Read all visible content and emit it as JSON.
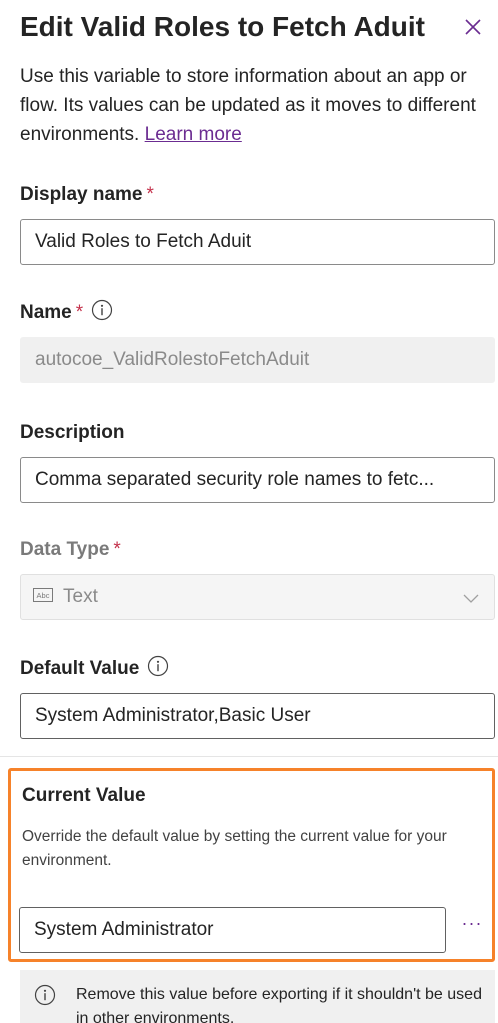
{
  "panel": {
    "title": "Edit Valid Roles to Fetch Aduit",
    "intro_text": "Use this variable to store information about an app or flow. Its values can be updated as it moves to different environments.",
    "learn_more": "Learn more"
  },
  "fields": {
    "display_name": {
      "label": "Display name",
      "required_mark": "*",
      "value": "Valid Roles to Fetch Aduit"
    },
    "name": {
      "label": "Name",
      "required_mark": "*",
      "value": "autocoe_ValidRolestoFetchAduit"
    },
    "description": {
      "label": "Description",
      "value": "Comma separated security role names to fetc..."
    },
    "data_type": {
      "label": "Data Type",
      "required_mark": "*",
      "value": "Text",
      "icon": "abc-text-icon"
    },
    "default_value": {
      "label": "Default Value",
      "value": "System Administrator,Basic User"
    },
    "current_value": {
      "label": "Current Value",
      "description": "Override the default value by setting the current value for your environment.",
      "value": "System Administrator",
      "more_label": "···"
    }
  },
  "notice": {
    "text": "Remove this value before exporting if it shouldn't be used in other environments."
  },
  "colors": {
    "accent": "#6b2c91",
    "required": "#c4314b",
    "highlight_border": "#f6822a"
  }
}
